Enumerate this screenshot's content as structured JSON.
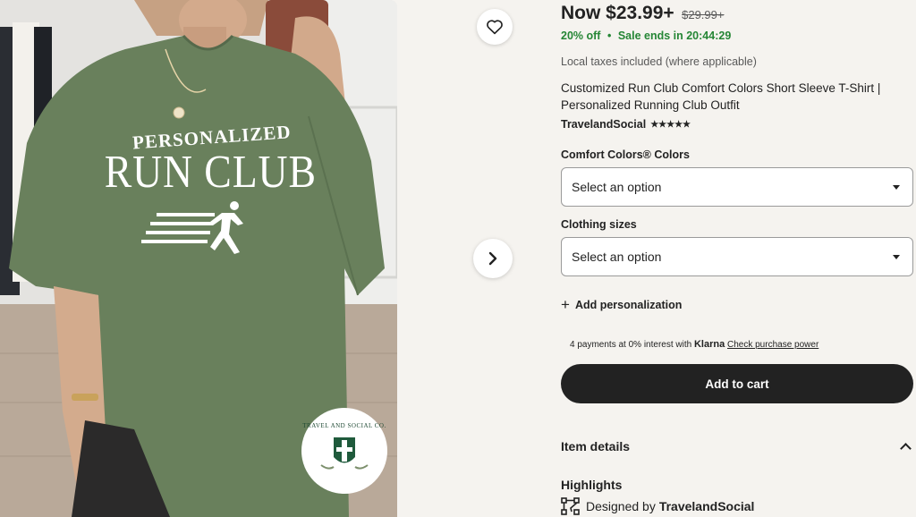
{
  "product_image": {
    "print_line1": "PERSONALIZED",
    "print_line2": "RUN CLUB",
    "badge_text": "TRAVEL AND SOCIAL CO."
  },
  "price": {
    "now": "Now $23.99+",
    "original": "$29.99+"
  },
  "sale": {
    "discount": "20% off",
    "separator": "•",
    "ends": "Sale ends in 20:44:29"
  },
  "taxes_note": "Local taxes included (where applicable)",
  "title": "Customized Run Club Comfort Colors Short Sleeve T-Shirt | Personalized Running Club Outfit",
  "shop": {
    "name": "TravelandSocial",
    "stars": "★★★★★"
  },
  "variations": [
    {
      "label": "Comfort Colors® Colors",
      "selected": "Select an option"
    },
    {
      "label": "Clothing sizes",
      "selected": "Select an option"
    }
  ],
  "personalize_label": "Add personalization",
  "klarna": {
    "text": "4 payments at 0% interest with",
    "brand": "Klarna",
    "link": "Check purchase power"
  },
  "add_to_cart": "Add to cart",
  "item_details": "Item details",
  "highlights": {
    "heading": "Highlights",
    "designed_by": "Designed by",
    "designer": "TravelandSocial"
  },
  "icons": {
    "favorite": "heart-icon",
    "next": "chevron-right-icon",
    "expand": "chevron-up-icon",
    "designed": "design-icon"
  },
  "colors": {
    "sale_green": "#258635",
    "button_dark": "#222222",
    "shirt": "#69805c",
    "background": "#f5f3ef"
  }
}
